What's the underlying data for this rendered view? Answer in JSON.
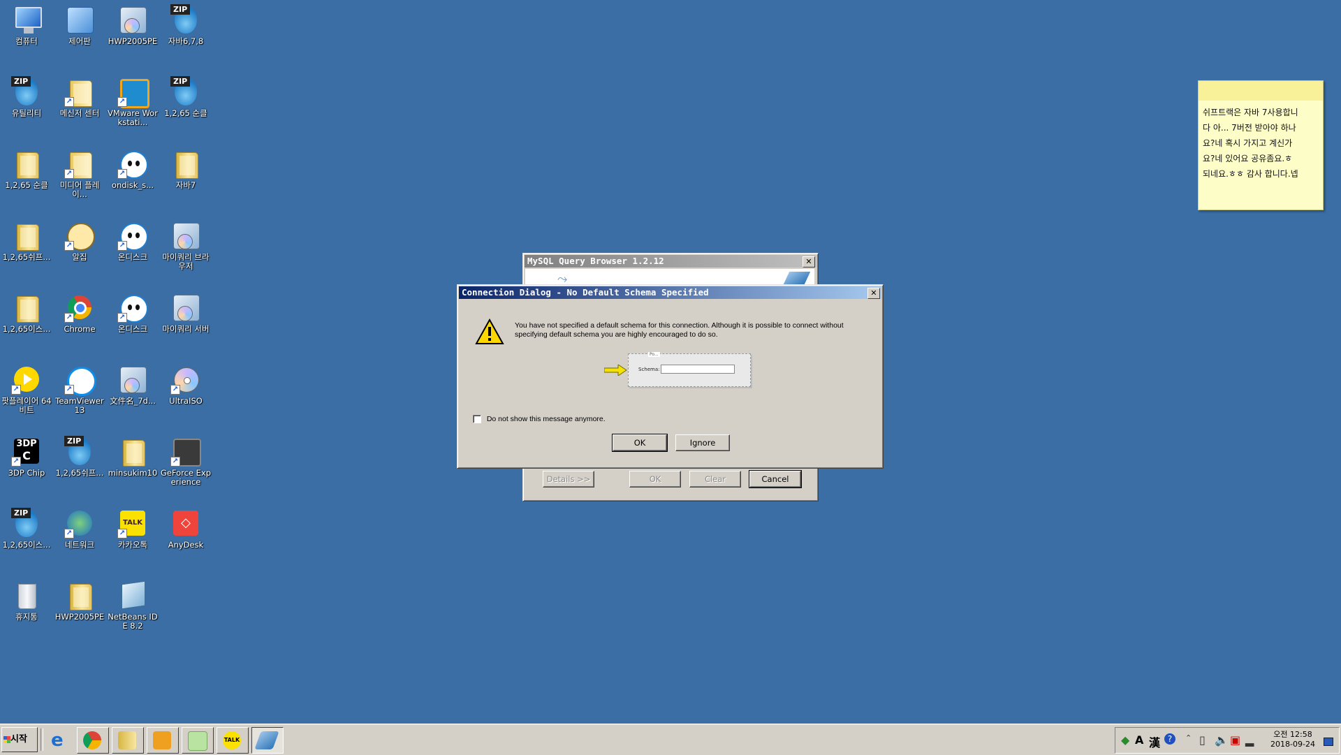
{
  "desktop": {
    "icons": [
      {
        "label": "컴퓨터",
        "kind": "computer"
      },
      {
        "label": "제어판",
        "kind": "control-panel"
      },
      {
        "label": "HWP2005PE",
        "kind": "installer"
      },
      {
        "label": "자바6,7,8",
        "kind": "zip"
      },
      {
        "label": "유틸리티",
        "kind": "zip"
      },
      {
        "label": "메신저 센터",
        "kind": "folder-shortcut"
      },
      {
        "label": "VMware Workstati...",
        "kind": "vmware"
      },
      {
        "label": "1,2,65 순클",
        "kind": "zip"
      },
      {
        "label": "1,2,65 순클",
        "kind": "folder"
      },
      {
        "label": "미디어 플레이...",
        "kind": "media-folder"
      },
      {
        "label": "ondisk_s...",
        "kind": "ondisk"
      },
      {
        "label": "자바7",
        "kind": "folder"
      },
      {
        "label": "1,2,65쉬프...",
        "kind": "folder"
      },
      {
        "label": "알집",
        "kind": "alzip"
      },
      {
        "label": "온디스크",
        "kind": "ondisk"
      },
      {
        "label": "마이쿼리 브라우저",
        "kind": "installer"
      },
      {
        "label": "1,2,65이스...",
        "kind": "folder"
      },
      {
        "label": "Chrome",
        "kind": "chrome"
      },
      {
        "label": "온디스크",
        "kind": "ondisk"
      },
      {
        "label": "마이쿼리 서버",
        "kind": "installer"
      },
      {
        "label": "팟플레이어 64 비트",
        "kind": "potplayer"
      },
      {
        "label": "TeamViewer 13",
        "kind": "teamviewer"
      },
      {
        "label": "文件名_7d...",
        "kind": "installer"
      },
      {
        "label": "UltraISO",
        "kind": "disc"
      },
      {
        "label": "3DP Chip",
        "kind": "3dp"
      },
      {
        "label": "1,2,65쉬프...",
        "kind": "zip"
      },
      {
        "label": "minsukim10",
        "kind": "user-folder"
      },
      {
        "label": "GeForce Experience",
        "kind": "geforce"
      },
      {
        "label": "1,2,65이스...",
        "kind": "zip"
      },
      {
        "label": "네트워크",
        "kind": "network"
      },
      {
        "label": "카카오톡",
        "kind": "kakao"
      },
      {
        "label": "AnyDesk",
        "kind": "anydesk"
      },
      {
        "label": "휴지통",
        "kind": "recycle"
      },
      {
        "label": "HWP2005PE",
        "kind": "folder"
      },
      {
        "label": "NetBeans IDE 8.2",
        "kind": "netbeans"
      }
    ]
  },
  "sticky_note": {
    "text": "쉬프트랙은 자바 7사용합니\n다 아... 7버전 받아야 하나\n요?네 혹시 가지고 계신가\n요?네 있어요 공유좀요.ㅎ\n되네요.ㅎㅎ 감사 합니다.넵"
  },
  "background_window": {
    "title": "MySQL Query Browser 1.2.12",
    "buttons": {
      "details": "Details >>",
      "ok": "OK",
      "clear": "Clear",
      "cancel": "Cancel"
    }
  },
  "dialog": {
    "title": "Connection Dialog - No Default Schema Specified",
    "message": "You have not specified a default schema for this connection. Although it is possible to connect without specifying default schema you are highly encouraged to do so.",
    "illustration": {
      "top_label": "Po...",
      "field_label": "Schema:"
    },
    "checkbox_label": "Do not show this message anymore.",
    "checkbox_checked": false,
    "ok_label": "OK",
    "ignore_label": "Ignore"
  },
  "taskbar": {
    "start_label": "시작",
    "tray": {
      "time": "오전 12:58",
      "date": "2018-09-24",
      "ime_a": "A",
      "ime_han": "漢"
    }
  },
  "colors": {
    "desktop": "#3a6ea5",
    "title_active_from": "#0a246a",
    "title_active_to": "#a6caf0",
    "title_inactive_from": "#808080",
    "title_inactive_to": "#c0c0c0",
    "face": "#d4d0c8"
  }
}
